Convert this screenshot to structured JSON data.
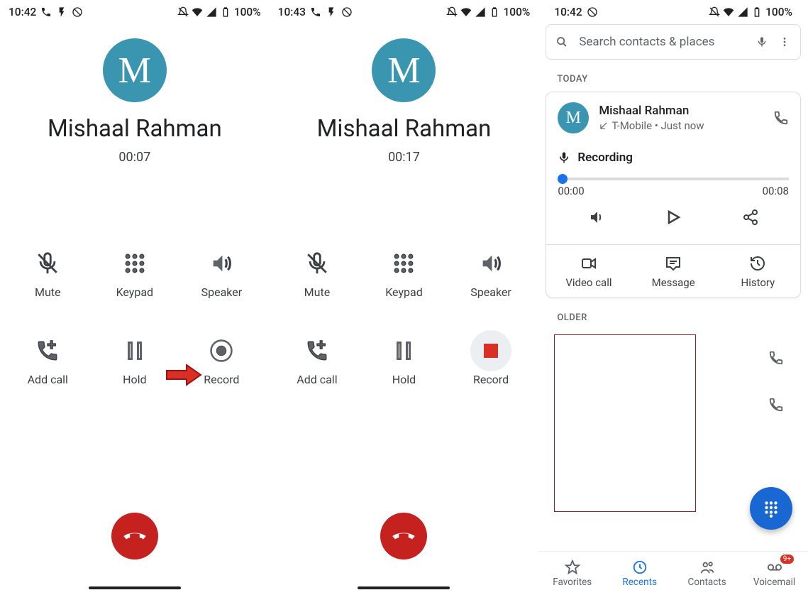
{
  "screens": [
    {
      "status": {
        "time": "10:42",
        "battery": "100%"
      },
      "avatar_letter": "M",
      "caller_name": "Mishaal Rahman",
      "timer": "00:07",
      "controls": {
        "mute": "Mute",
        "keypad": "Keypad",
        "speaker": "Speaker",
        "add_call": "Add call",
        "hold": "Hold",
        "record": "Record"
      }
    },
    {
      "status": {
        "time": "10:43",
        "battery": "100%"
      },
      "avatar_letter": "M",
      "caller_name": "Mishaal Rahman",
      "timer": "00:17",
      "controls": {
        "mute": "Mute",
        "keypad": "Keypad",
        "speaker": "Speaker",
        "add_call": "Add call",
        "hold": "Hold",
        "record": "Record"
      }
    },
    {
      "status": {
        "time": "10:42",
        "battery": "100%"
      },
      "search_placeholder": "Search contacts & places",
      "today_label": "TODAY",
      "call_entry": {
        "avatar_letter": "M",
        "name": "Mishaal Rahman",
        "meta": "T-Mobile • Just now"
      },
      "recording": {
        "title": "Recording",
        "current": "00:00",
        "total": "00:08"
      },
      "actions": {
        "video": "Video call",
        "message": "Message",
        "history": "History"
      },
      "older_label": "OLDER",
      "nav": {
        "favorites": "Favorites",
        "recents": "Recents",
        "contacts": "Contacts",
        "voicemail": "Voicemail",
        "voicemail_badge": "9+"
      }
    }
  ]
}
